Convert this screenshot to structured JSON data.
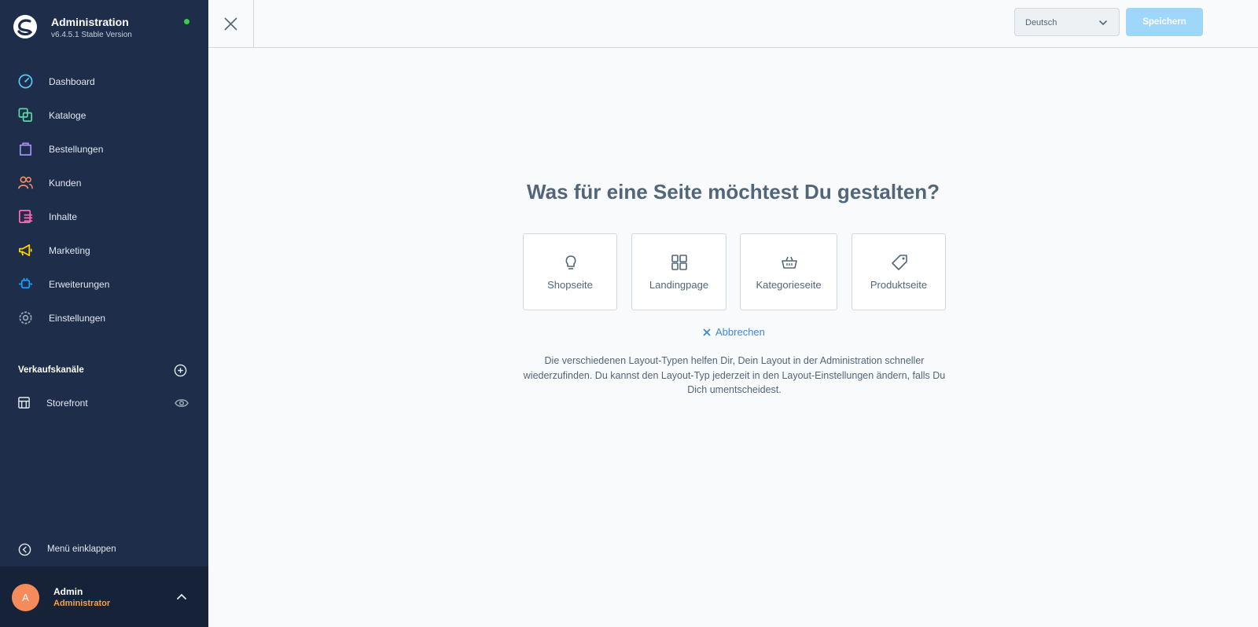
{
  "brand": {
    "title": "Administration",
    "version": "v6.4.5.1 Stable Version"
  },
  "nav": {
    "items": [
      {
        "label": "Dashboard",
        "icon": "dashboard-icon",
        "color": "#5fc5f5"
      },
      {
        "label": "Kataloge",
        "icon": "catalog-icon",
        "color": "#57d9a3"
      },
      {
        "label": "Bestellungen",
        "icon": "orders-icon",
        "color": "#a092f0"
      },
      {
        "label": "Kunden",
        "icon": "customers-icon",
        "color": "#f88962"
      },
      {
        "label": "Inhalte",
        "icon": "content-icon",
        "color": "#ff68b4"
      },
      {
        "label": "Marketing",
        "icon": "marketing-icon",
        "color": "#ffd700"
      },
      {
        "label": "Erweiterungen",
        "icon": "extensions-icon",
        "color": "#189eff"
      },
      {
        "label": "Einstellungen",
        "icon": "settings-icon",
        "color": "#9aa8b5"
      }
    ]
  },
  "sales_channels": {
    "title": "Verkaufskanäle",
    "items": [
      {
        "label": "Storefront"
      }
    ]
  },
  "collapse_label": "Menü einklappen",
  "user": {
    "initial": "A",
    "name": "Admin",
    "role": "Administrator"
  },
  "topbar": {
    "language": "Deutsch",
    "save_label": "Speichern"
  },
  "main": {
    "heading": "Was für eine Seite möchtest Du gestalten?",
    "cards": [
      {
        "label": "Shopseite",
        "icon": "lightbulb-icon"
      },
      {
        "label": "Landingpage",
        "icon": "layout-grid-icon"
      },
      {
        "label": "Kategorieseite",
        "icon": "basket-icon"
      },
      {
        "label": "Produktseite",
        "icon": "tag-icon"
      }
    ],
    "cancel_label": "Abbrechen",
    "help_text": "Die verschiedenen Layout-Typen helfen Dir, Dein Layout in der Administration schneller wiederzufinden. Du kannst den Layout-Typ jederzeit in den Layout-Einstellungen ändern, falls Du Dich umentscheidest."
  },
  "colors": {
    "sidebar_bg": "#1d2d4a",
    "accent": "#189eff",
    "save_button_disabled": "#9fd7fb",
    "status_online": "#37d046",
    "avatar": "#f58a5a"
  }
}
